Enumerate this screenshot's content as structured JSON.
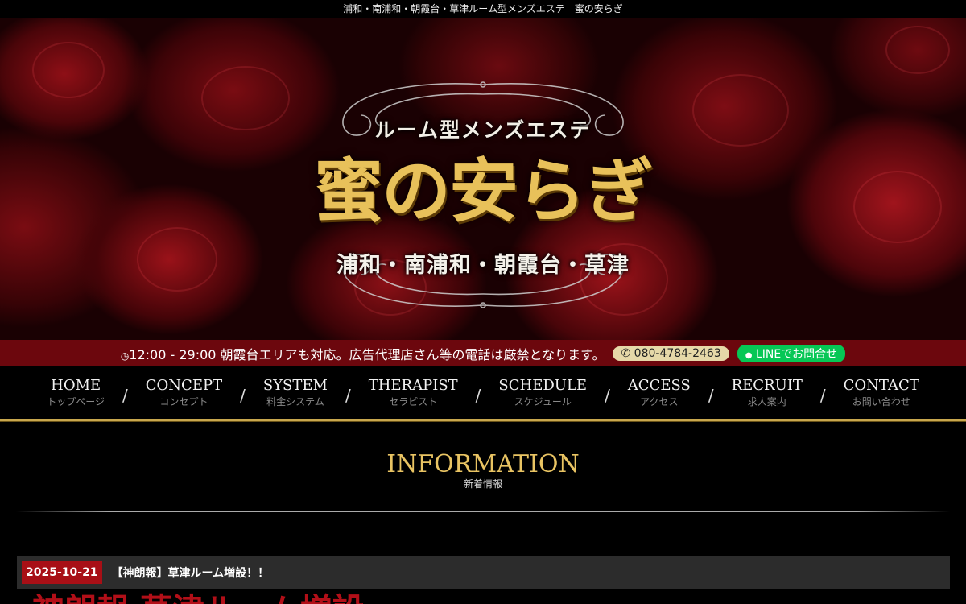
{
  "site": {
    "top_title": "浦和・南浦和・朝霞台・草津ルーム型メンズエステ　蜜の安らぎ"
  },
  "hero": {
    "sub_title": "ルーム型メンズエステ",
    "logo_text": "蜜の安らぎ",
    "area_text": "浦和・南浦和・朝霞台・草津"
  },
  "info_bar": {
    "clock_icon": "clock-icon",
    "hours_text": "12:00 - 29:00 朝霞台エリアも対応。広告代理店さん等の電話は厳禁となります。",
    "phone_icon": "phone-icon",
    "phone_number": "080-4784-2463",
    "line_icon": "line-chat-icon",
    "line_label": "LINEでお問合せ",
    "colors": {
      "bar": "#6c070d",
      "phone_pill": "#e6d8a8",
      "line_pill": "#06c755"
    }
  },
  "nav": {
    "items": [
      {
        "en": "HOME",
        "jp": "トップページ"
      },
      {
        "en": "CONCEPT",
        "jp": "コンセプト"
      },
      {
        "en": "SYSTEM",
        "jp": "料金システム"
      },
      {
        "en": "THERAPIST",
        "jp": "セラピスト"
      },
      {
        "en": "SCHEDULE",
        "jp": "スケジュール"
      },
      {
        "en": "ACCESS",
        "jp": "アクセス"
      },
      {
        "en": "RECRUIT",
        "jp": "求人案内"
      },
      {
        "en": "CONTACT",
        "jp": "お問い合わせ"
      }
    ],
    "separator": "/",
    "accent_color": "#c8a74e"
  },
  "information": {
    "heading_en": "INFORMATION",
    "heading_jp": "新着情報",
    "news": [
      {
        "date": "2025-10-21",
        "title": "【神朗報】草津ルーム増設！！"
      }
    ],
    "partial_text": "神朗報 草津ルーム増設"
  },
  "colors": {
    "gold": "#e9c463",
    "red": "#a80f16"
  }
}
